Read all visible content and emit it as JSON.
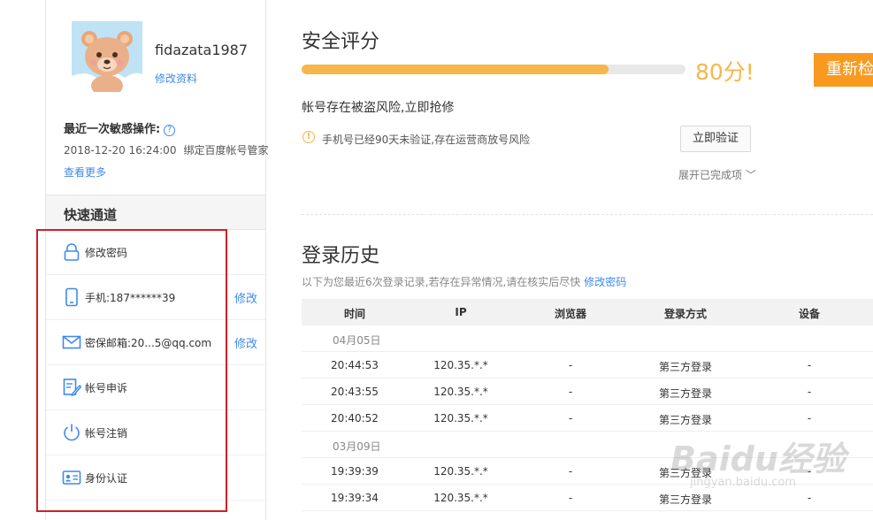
{
  "profile": {
    "username": "fidazata1987",
    "edit_profile": "修改资料"
  },
  "recent": {
    "title": "最近一次敏感操作:",
    "help": "?",
    "time": "2018-12-20 16:24:00",
    "action": "绑定百度帐号管家",
    "see_more": "查看更多"
  },
  "quick": {
    "title": "快速通道",
    "items": [
      {
        "icon": "lock-icon",
        "label": "修改密码"
      },
      {
        "icon": "phone-icon",
        "label": "手机:187******39",
        "edit": "修改"
      },
      {
        "icon": "mail-icon",
        "label": "密保邮箱:20...5@qq.com",
        "edit": "修改"
      },
      {
        "icon": "appeal-icon",
        "label": "帐号申诉"
      },
      {
        "icon": "power-icon",
        "label": "帐号注销"
      },
      {
        "icon": "id-card-icon",
        "label": "身份认证"
      }
    ]
  },
  "security": {
    "title": "安全评分",
    "score_percent": 80,
    "score_label": "80分!",
    "rescan": "重新检",
    "risk_text": "帐号存在被盗风险,立即抢修",
    "warning_icon": "!",
    "warning_text": "手机号已经90天未验证,存在运营商放号风险",
    "verify_button": "立即验证",
    "expand_done": "展开已完成项",
    "expand_chevron": "﹀"
  },
  "history": {
    "title": "登录历史",
    "desc": "以下为您最近6次登录记录,若存在异常情况,请在核实后尽快",
    "desc_link": "修改密码",
    "columns": [
      "时间",
      "IP",
      "浏览器",
      "登录方式",
      "设备"
    ],
    "groups": [
      {
        "date": "04月05日",
        "rows": [
          [
            "20:44:53",
            "120.35.*.*",
            "-",
            "第三方登录",
            "-"
          ],
          [
            "20:43:55",
            "120.35.*.*",
            "-",
            "第三方登录",
            "-"
          ],
          [
            "20:40:52",
            "120.35.*.*",
            "-",
            "第三方登录",
            "-"
          ]
        ]
      },
      {
        "date": "03月09日",
        "rows": [
          [
            "19:39:39",
            "120.35.*.*",
            "-",
            "第三方登录",
            "-"
          ],
          [
            "19:39:34",
            "120.35.*.*",
            "-",
            "第三方登录",
            "-"
          ]
        ]
      }
    ]
  },
  "watermark": {
    "logo": "Baidu经验",
    "sub": "jingyan.baidu.com"
  },
  "colors": {
    "accent_blue": "#3f89ec",
    "score_orange": "#f6b64a",
    "button_orange": "#f79a1f",
    "highlight_red": "#d01f26"
  }
}
